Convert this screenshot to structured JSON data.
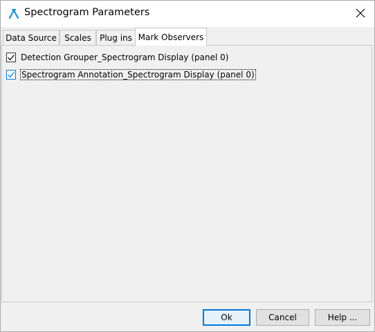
{
  "window": {
    "title": "Spectrogram Parameters",
    "app_icon": "spectrogram-app-icon",
    "close_icon": "close-icon"
  },
  "tabs": [
    {
      "label": "Data Source",
      "active": false
    },
    {
      "label": "Scales",
      "active": false
    },
    {
      "label": "Plug ins",
      "active": false
    },
    {
      "label": "Mark Observers",
      "active": true
    }
  ],
  "observers": [
    {
      "label": "Detection Grouper_Spectrogram Display (panel 0)",
      "checked": true
    },
    {
      "label": "Spectrogram Annotation_Spectrogram Display (panel 0)",
      "checked": true,
      "focused": true
    }
  ],
  "buttons": {
    "ok": "Ok",
    "cancel": "Cancel",
    "help": "Help ..."
  },
  "colors": {
    "accent": "#0078d7",
    "dialog_bg": "#f0f0f0",
    "titlebar_bg": "#ffffff"
  }
}
